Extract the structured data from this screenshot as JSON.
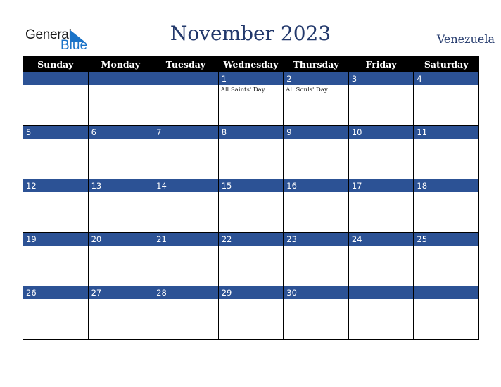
{
  "logo": {
    "general": "General",
    "blue": "Blue"
  },
  "title": "November 2023",
  "country": "Venezuela",
  "colors": {
    "accent": "#2c5295",
    "header_bg": "#000000",
    "title": "#22386b",
    "logo_blue": "#1a73c8"
  },
  "weekdays": [
    "Sunday",
    "Monday",
    "Tuesday",
    "Wednesday",
    "Thursday",
    "Friday",
    "Saturday"
  ],
  "weeks": [
    [
      {
        "day": "",
        "event": ""
      },
      {
        "day": "",
        "event": ""
      },
      {
        "day": "",
        "event": ""
      },
      {
        "day": "1",
        "event": "All Saints' Day"
      },
      {
        "day": "2",
        "event": "All Souls' Day"
      },
      {
        "day": "3",
        "event": ""
      },
      {
        "day": "4",
        "event": ""
      }
    ],
    [
      {
        "day": "5",
        "event": ""
      },
      {
        "day": "6",
        "event": ""
      },
      {
        "day": "7",
        "event": ""
      },
      {
        "day": "8",
        "event": ""
      },
      {
        "day": "9",
        "event": ""
      },
      {
        "day": "10",
        "event": ""
      },
      {
        "day": "11",
        "event": ""
      }
    ],
    [
      {
        "day": "12",
        "event": ""
      },
      {
        "day": "13",
        "event": ""
      },
      {
        "day": "14",
        "event": ""
      },
      {
        "day": "15",
        "event": ""
      },
      {
        "day": "16",
        "event": ""
      },
      {
        "day": "17",
        "event": ""
      },
      {
        "day": "18",
        "event": ""
      }
    ],
    [
      {
        "day": "19",
        "event": ""
      },
      {
        "day": "20",
        "event": ""
      },
      {
        "day": "21",
        "event": ""
      },
      {
        "day": "22",
        "event": ""
      },
      {
        "day": "23",
        "event": ""
      },
      {
        "day": "24",
        "event": ""
      },
      {
        "day": "25",
        "event": ""
      }
    ],
    [
      {
        "day": "26",
        "event": ""
      },
      {
        "day": "27",
        "event": ""
      },
      {
        "day": "28",
        "event": ""
      },
      {
        "day": "29",
        "event": ""
      },
      {
        "day": "30",
        "event": ""
      },
      {
        "day": "",
        "event": ""
      },
      {
        "day": "",
        "event": ""
      }
    ]
  ]
}
